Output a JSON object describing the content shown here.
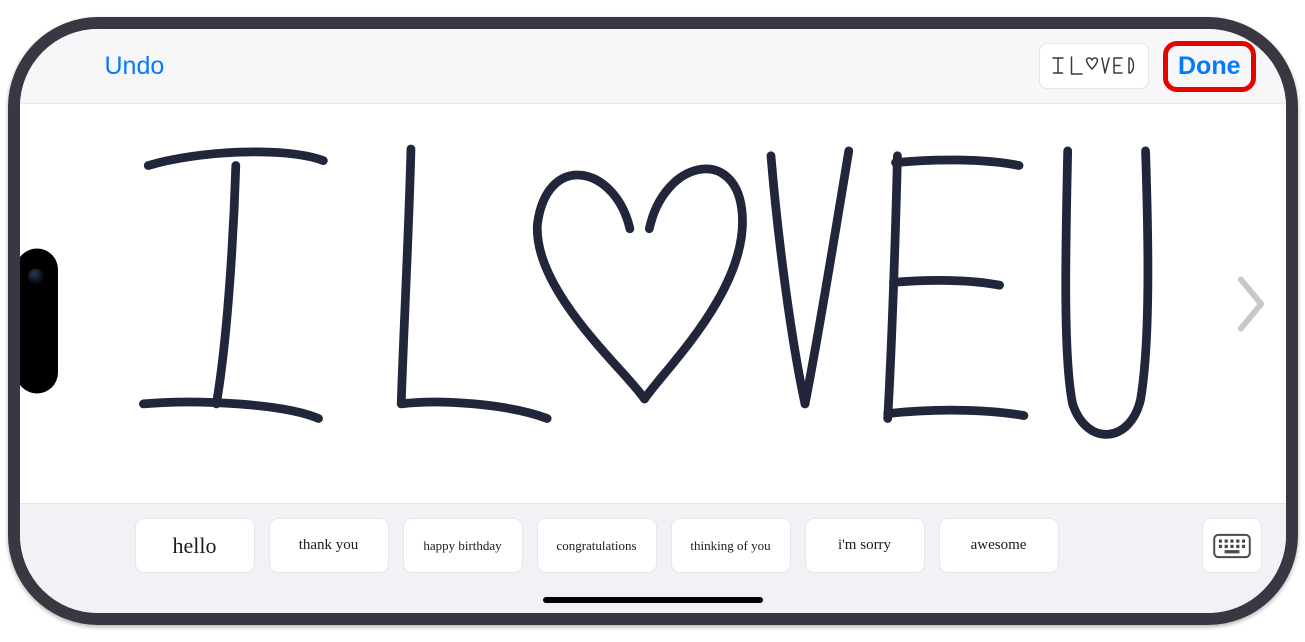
{
  "topbar": {
    "undo_label": "Undo",
    "done_label": "Done",
    "preview_text": "I L♡VE U"
  },
  "canvas": {
    "handwriting_text": "I L♡VE U",
    "stroke_color": "#22263a"
  },
  "suggestions": [
    {
      "label": "hello"
    },
    {
      "label": "thank you"
    },
    {
      "label": "happy birthday"
    },
    {
      "label": "congratulations"
    },
    {
      "label": "thinking of you"
    },
    {
      "label": "i'm sorry"
    },
    {
      "label": "awesome"
    }
  ],
  "annotation": {
    "highlight_target": "done-button",
    "highlight_color": "#e10600"
  }
}
